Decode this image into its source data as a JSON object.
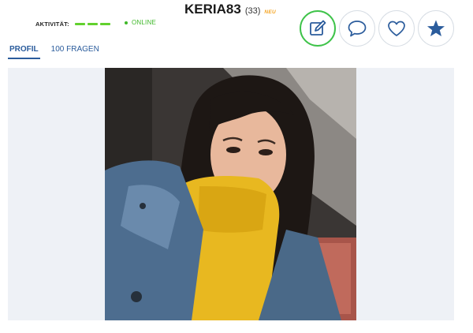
{
  "profile": {
    "username": "KERIA83",
    "age": "(33)",
    "new_badge": "NEU"
  },
  "status": {
    "activity_label": "AKTIVITÄT:",
    "activity_level": 3,
    "online_label": "ONLINE"
  },
  "tabs": [
    {
      "label": "PROFIL",
      "active": true
    },
    {
      "label": "100 FRAGEN",
      "active": false
    }
  ],
  "actions": {
    "icons": [
      "edit-icon",
      "chat-icon",
      "heart-icon",
      "star-icon"
    ]
  },
  "colors": {
    "accent_blue": "#2b5c9c",
    "online_green": "#3fb829",
    "activity_green": "#62d12e",
    "new_orange": "#f5a524",
    "active_border": "#3fc34a"
  },
  "photo": {
    "subject": "profile-photo"
  }
}
